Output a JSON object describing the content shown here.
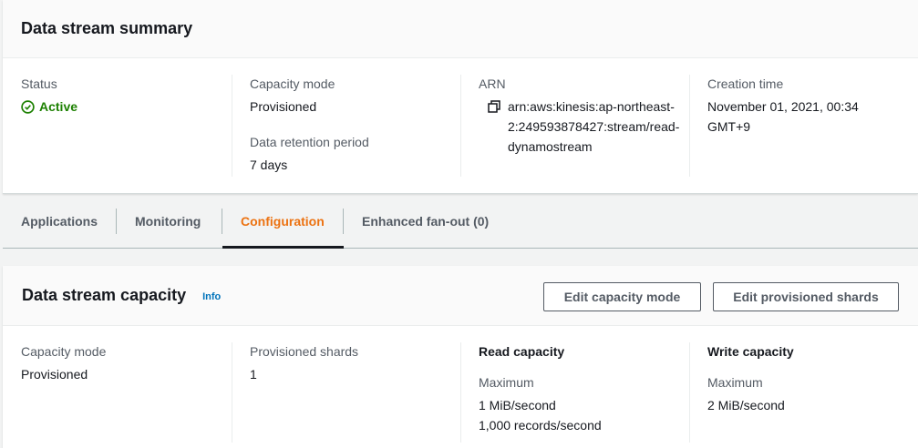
{
  "summary": {
    "title": "Data stream summary",
    "status": {
      "label": "Status",
      "value": "Active"
    },
    "capacity_mode": {
      "label": "Capacity mode",
      "value": "Provisioned"
    },
    "retention": {
      "label": "Data retention period",
      "value": "7 days"
    },
    "arn": {
      "label": "ARN",
      "value": "arn:aws:kinesis:ap-northeast-2:249593878427:stream/read-dynamostream"
    },
    "creation_time": {
      "label": "Creation time",
      "value": "November 01, 2021, 00:34 GMT+9"
    }
  },
  "tabs": [
    {
      "label": "Applications"
    },
    {
      "label": "Monitoring"
    },
    {
      "label": "Configuration"
    },
    {
      "label": "Enhanced fan-out (0)"
    }
  ],
  "capacity": {
    "title": "Data stream capacity",
    "info": "Info",
    "edit_capacity_mode": "Edit capacity mode",
    "edit_provisioned_shards": "Edit provisioned shards",
    "capacity_mode": {
      "label": "Capacity mode",
      "value": "Provisioned"
    },
    "shards": {
      "label": "Provisioned shards",
      "value": "1"
    },
    "read": {
      "label": "Read capacity",
      "sub": "Maximum",
      "line1": "1 MiB/second",
      "line2": "1,000 records/second"
    },
    "write": {
      "label": "Write capacity",
      "sub": "Maximum",
      "line1": "2 MiB/second"
    }
  },
  "colors": {
    "active": "#1d8102",
    "tab_active": "#ec7211",
    "link": "#0073bb"
  },
  "icons": {
    "status": "check-circle-icon",
    "arn": "copy-icon"
  }
}
